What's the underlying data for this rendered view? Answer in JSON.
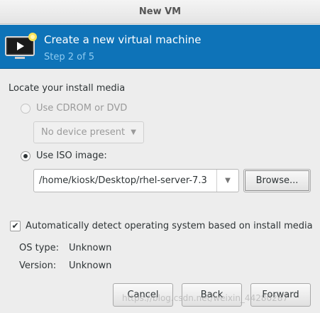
{
  "window": {
    "title": "New VM"
  },
  "banner": {
    "title": "Create a new virtual machine",
    "step": "Step 2 of 5",
    "icon": "vm-monitor-icon"
  },
  "install_media": {
    "section_label": "Locate your install media",
    "cdrom_option": {
      "label": "Use CDROM or DVD",
      "selected": false,
      "enabled": false
    },
    "cdrom_device": {
      "value": "No device present",
      "enabled": false
    },
    "iso_option": {
      "label": "Use ISO image:",
      "selected": true,
      "enabled": true
    },
    "iso_path": {
      "value": "/home/kiosk/Desktop/rhel-server-7.3"
    },
    "browse_label": "Browse..."
  },
  "os_detect": {
    "checkbox_label": "Automatically detect operating system based on install media",
    "checked": true,
    "os_type_label": "OS type:",
    "os_type_value": "Unknown",
    "version_label": "Version:",
    "version_value": "Unknown"
  },
  "footer": {
    "cancel_label": "Cancel",
    "back_label": "Back",
    "forward_label": "Forward"
  },
  "watermark": "https://blog.csdn.net/weixin_44280287",
  "colors": {
    "banner": "#0e73b8",
    "step_text": "#8ecbf1",
    "window_bg": "#ededed"
  }
}
